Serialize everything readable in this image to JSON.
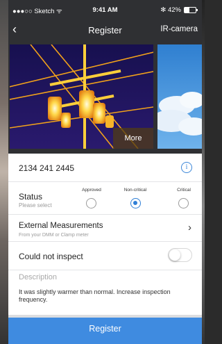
{
  "status_bar": {
    "carrier": "●●●○○ Sketch ᯤ",
    "time": "9:41 AM",
    "bluetooth_battery": "✻ 42%",
    "battery_level": 0.42
  },
  "nav": {
    "back_glyph": "‹",
    "title": "Register",
    "right_action": "IR-camera"
  },
  "gallery": {
    "more_label": "More"
  },
  "asset": {
    "id": "2134 241 2445",
    "info_glyph": "i"
  },
  "status": {
    "label": "Status",
    "hint": "Please select",
    "options": [
      {
        "label": "Approved",
        "selected": false
      },
      {
        "label": "Non-critical",
        "selected": true
      },
      {
        "label": "Critical",
        "selected": false
      }
    ]
  },
  "external": {
    "title": "External Measurements",
    "subtitle": "From your DMM or Clamp meter",
    "chevron": "›"
  },
  "inspect": {
    "label": "Could not inspect",
    "enabled": false
  },
  "description": {
    "label": "Description",
    "text": "It was slightly warmer than normal. Increase inspection frequency."
  },
  "footer": {
    "register_label": "Register"
  },
  "colors": {
    "accent": "#3f8be0",
    "nav_bg": "#2f3033"
  }
}
